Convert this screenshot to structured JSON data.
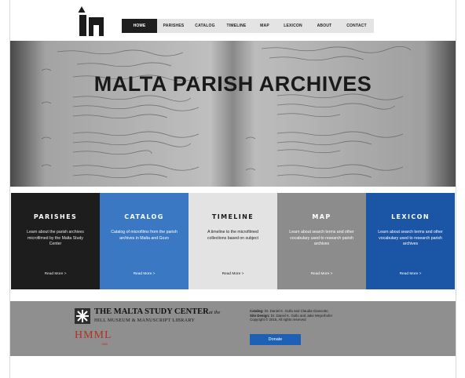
{
  "header": {
    "logo_icon": "malta-study-center-logo",
    "nav": [
      "HOME",
      "PARISHES",
      "CATALOG",
      "TIMELINE",
      "MAP",
      "LEXICON",
      "ABOUT",
      "CONTACT"
    ],
    "active_nav": "HOME"
  },
  "hero": {
    "title": "MALTA PARISH ARCHIVES",
    "background": "manuscript-ledger-photo"
  },
  "tiles": [
    {
      "title": "PARISHES",
      "desc": "Learn about the parish archives microfilmed by the Malta Study Center",
      "more": "Read More >",
      "bg": "#1d1d1d",
      "title_color": "#ffffff",
      "text_color": "#e8e8e8"
    },
    {
      "title": "CATALOG",
      "desc": "Catalog of microfilms from the parish archives in Malta and Gozo",
      "more": "Read More >",
      "bg": "#3a78c3",
      "title_color": "#ffffff",
      "text_color": "#ffffff"
    },
    {
      "title": "TIMELINE",
      "desc": "A timeline to the microfilmed collections based on subject",
      "more": "Read More >",
      "bg": "#e3e3e3",
      "title_color": "#1a1a1a",
      "text_color": "#1a1a1a"
    },
    {
      "title": "MAP",
      "desc": "Learn about search terms and other vocabulary used to research parish archives",
      "more": "Read More >",
      "bg": "#8c8c8c",
      "title_color": "#ffffff",
      "text_color": "#ffffff"
    },
    {
      "title": "LEXICON",
      "desc": "Learn about search terms and other vocabulary used to research parish archives",
      "more": "Read More >",
      "bg": "#1a55a6",
      "title_color": "#ffffff",
      "text_color": "#ffffff"
    }
  ],
  "footer": {
    "center_name": "THE MALTA STUDY CENTER",
    "center_name_suffix": "at the",
    "center_sub": "HILL MUSEUM & MANUSCRIPT LIBRARY",
    "hmml": "HMML",
    "hmml_year": "1965",
    "catalog_label": "Catalog:",
    "catalog_value": "Dr. Daniel K. Gullo and Claudia Giancotto",
    "design_label": "Site Design:",
    "design_value": "Dr. Daniel K. Gullo and Jake Meyerhofer",
    "copyright": "Copyright © 2015, All rights reserved",
    "donate": "Donate",
    "accent": "#b43020",
    "donate_color": "#1e60b3"
  }
}
